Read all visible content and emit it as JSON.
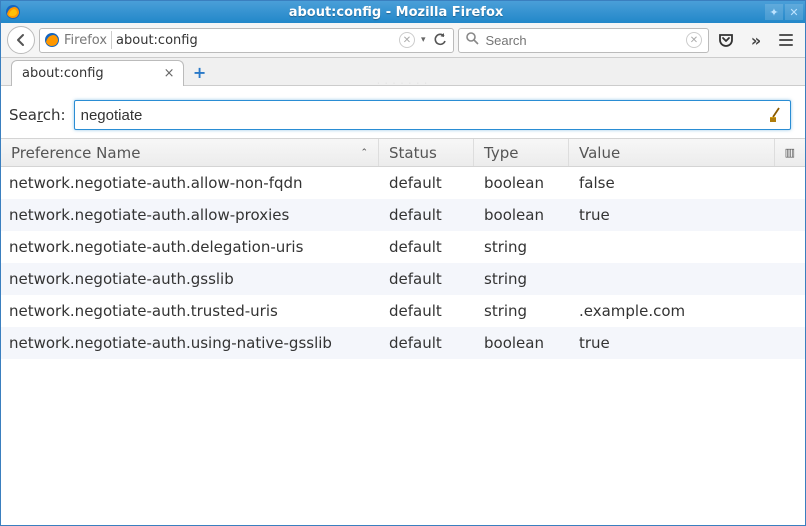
{
  "window": {
    "title": "about:config - Mozilla Firefox"
  },
  "urlbar": {
    "identity": "Firefox",
    "url": "about:config"
  },
  "searchbar": {
    "placeholder": "Search"
  },
  "tabs": [
    {
      "label": "about:config"
    }
  ],
  "config_search": {
    "label_prefix": "Sea",
    "label_ul": "r",
    "label_suffix": "ch:",
    "value": "negotiate"
  },
  "columns": {
    "name": "Preference Name",
    "status": "Status",
    "type": "Type",
    "value": "Value"
  },
  "prefs": [
    {
      "name": "network.negotiate-auth.allow-non-fqdn",
      "status": "default",
      "type": "boolean",
      "value": "false"
    },
    {
      "name": "network.negotiate-auth.allow-proxies",
      "status": "default",
      "type": "boolean",
      "value": "true"
    },
    {
      "name": "network.negotiate-auth.delegation-uris",
      "status": "default",
      "type": "string",
      "value": ""
    },
    {
      "name": "network.negotiate-auth.gsslib",
      "status": "default",
      "type": "string",
      "value": ""
    },
    {
      "name": "network.negotiate-auth.trusted-uris",
      "status": "default",
      "type": "string",
      "value": ".example.com"
    },
    {
      "name": "network.negotiate-auth.using-native-gsslib",
      "status": "default",
      "type": "boolean",
      "value": "true"
    }
  ]
}
